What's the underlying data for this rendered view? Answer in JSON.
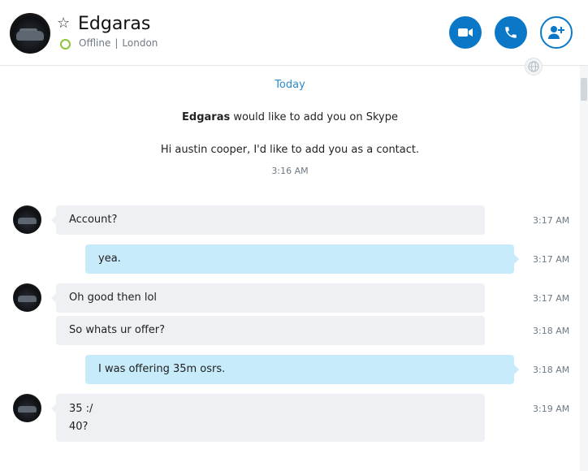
{
  "header": {
    "name": "Edgaras",
    "status": "Offline",
    "location": "London",
    "separator": "|",
    "icons": {
      "favorite": "star-outline-icon",
      "video": "video-call-icon",
      "call": "phone-call-icon",
      "add": "add-contact-icon",
      "language": "globe-icon"
    },
    "colors": {
      "accent": "#0b78c7",
      "status": "#8cc43a"
    }
  },
  "conversation": {
    "day_label": "Today",
    "request": {
      "sender": "Edgaras",
      "text": "would like to add you on Skype",
      "message": "Hi austin cooper, I'd like to add you as a contact.",
      "time": "3:16 AM"
    },
    "messages": [
      {
        "from": "Edgaras",
        "direction": "in",
        "lines": [
          "Account?"
        ],
        "time": "3:17 AM"
      },
      {
        "from": "me",
        "direction": "out",
        "lines": [
          "yea."
        ],
        "time": "3:17 AM"
      },
      {
        "from": "Edgaras",
        "direction": "in",
        "lines": [
          "Oh good then lol"
        ],
        "time": "3:17 AM"
      },
      {
        "from": "Edgaras",
        "direction": "in",
        "lines": [
          "So whats ur offer?"
        ],
        "time": "3:18 AM"
      },
      {
        "from": "me",
        "direction": "out",
        "lines": [
          "I was offering 35m osrs."
        ],
        "time": "3:18 AM"
      },
      {
        "from": "Edgaras",
        "direction": "in",
        "lines": [
          "35 :/",
          "40?"
        ],
        "time": "3:19 AM"
      }
    ]
  }
}
